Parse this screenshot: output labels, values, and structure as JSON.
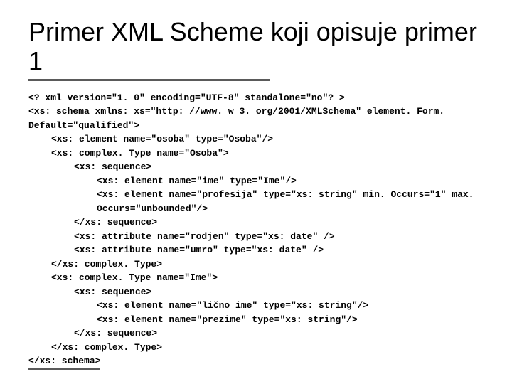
{
  "title": "Primer XML Scheme koji opisuje primer 1",
  "code_lines": [
    {
      "indent": 0,
      "text": "<? xml version=\"1. 0\" encoding=\"UTF-8\" standalone=\"no\"? >"
    },
    {
      "indent": 0,
      "text": "<xs: schema xmlns: xs=\"http: //www. w 3. org/2001/XMLSchema\" element. Form. Default=\"qualified\">"
    },
    {
      "indent": 1,
      "text": "<xs: element name=\"osoba\" type=\"Osoba\"/>"
    },
    {
      "indent": 1,
      "text": "<xs: complex. Type name=\"Osoba\">"
    },
    {
      "indent": 2,
      "text": "<xs: sequence>"
    },
    {
      "indent": 3,
      "text": "<xs: element name=\"ime\" type=\"Ime\"/>"
    },
    {
      "indent": 3,
      "text": "<xs: element name=\"profesija\" type=\"xs: string\" min. Occurs=\"1\" max. Occurs=\"unbounded\"/>"
    },
    {
      "indent": 2,
      "text": "</xs: sequence>"
    },
    {
      "indent": 2,
      "text": "<xs: attribute name=\"rodjen\" type=\"xs: date\" />"
    },
    {
      "indent": 2,
      "text": "<xs: attribute name=\"umro\" type=\"xs: date\" />"
    },
    {
      "indent": 1,
      "text": "</xs: complex. Type>"
    },
    {
      "indent": 1,
      "text": "<xs: complex. Type name=\"Ime\">"
    },
    {
      "indent": 2,
      "text": "<xs: sequence>"
    },
    {
      "indent": 3,
      "text": "<xs: element name=\"lično_ime\" type=\"xs: string\"/>"
    },
    {
      "indent": 3,
      "text": "<xs: element name=\"prezime\" type=\"xs: string\"/>"
    },
    {
      "indent": 2,
      "text": "</xs: sequence>"
    },
    {
      "indent": 1,
      "text": "</xs: complex. Type>"
    },
    {
      "indent": 0,
      "text": "</xs: schema>",
      "underline": true
    }
  ]
}
